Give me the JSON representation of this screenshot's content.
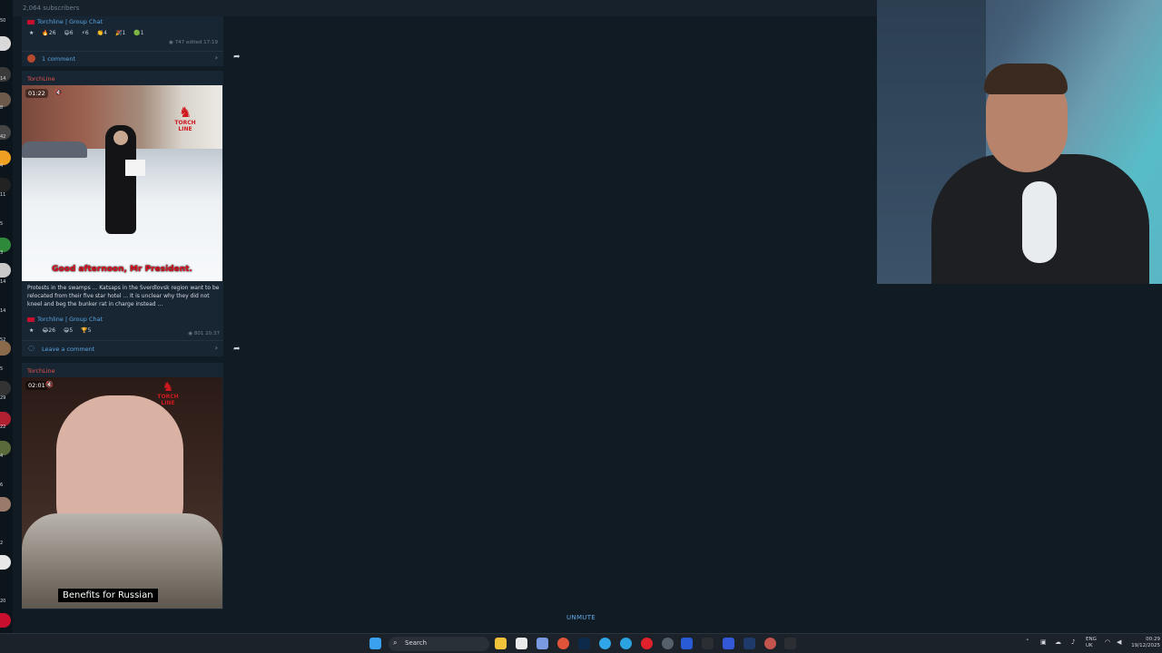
{
  "topbar": {
    "subscribers": "2,064 subscribers"
  },
  "post1": {
    "group_link": "Torchline | Group Chat",
    "reactions": [
      "26",
      "6",
      "6",
      "4",
      "1",
      "1"
    ],
    "views": "747",
    "edited": "edited 17:19",
    "comments": "1 comment"
  },
  "post2": {
    "channel": "TorchLine",
    "duration": "01:22",
    "subtitle": "Good afternoon, Mr President.",
    "watermark": "TORCH LINE",
    "caption": "Protests in the swamps ... Katsaps in the Sverdlovsk region want to be relocated from their five star hotel ... It is unclear why they did not kneel and beg the bunker rat in charge instead ...",
    "group_link": "Torchline | Group Chat",
    "reactions": [
      "26",
      "5",
      "5"
    ],
    "views": "801",
    "time": "20:37",
    "comment_prompt": "Leave a comment"
  },
  "post3": {
    "channel": "TorchLine",
    "duration": "02:01",
    "subtitle": "Benefits for Russian",
    "watermark": "TORCH LINE"
  },
  "player": {
    "unmute_label": "UNMUTE"
  },
  "taskbar": {
    "search_label": "Search",
    "tray_lang": "ENG",
    "tray_region": "UK",
    "clock_time": "00:29",
    "clock_date": "19/12/2025"
  },
  "sidebar_counts": [
    "50",
    "70",
    "14",
    "8",
    "42",
    "4",
    "11",
    "5",
    "3",
    "14",
    "14",
    "52",
    "5",
    "29",
    "22",
    "4",
    "6",
    "2",
    "20"
  ],
  "colors": {
    "accent": "#5aa6e0",
    "channel": "#e5534b",
    "background": "#111b24"
  }
}
